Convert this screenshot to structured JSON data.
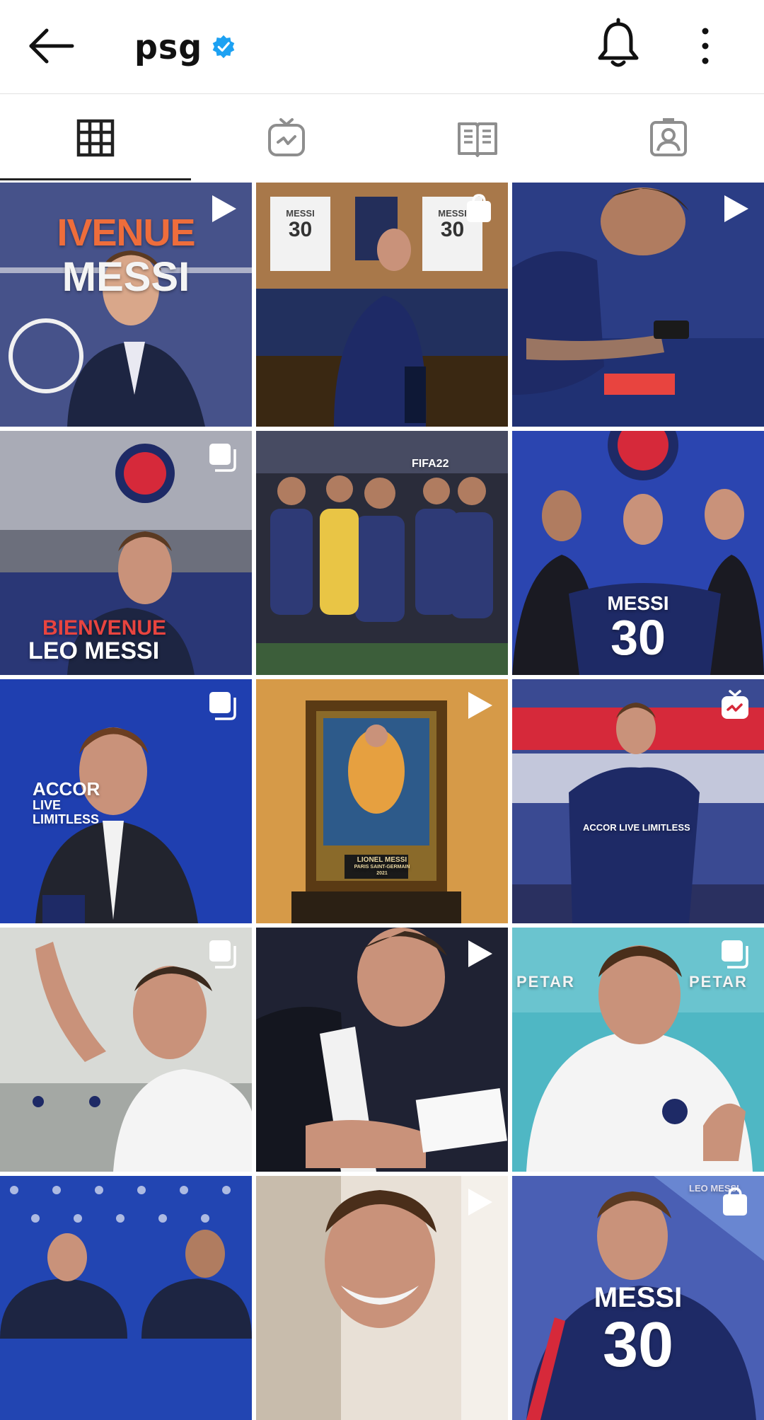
{
  "header": {
    "title": "psg",
    "verified": true,
    "back_icon": "arrow-left-icon",
    "bell_icon": "bell-icon",
    "more_icon": "more-vertical-icon"
  },
  "tabs": [
    {
      "name": "grid",
      "icon": "grid-icon",
      "active": true
    },
    {
      "name": "igtv",
      "icon": "igtv-icon",
      "active": false
    },
    {
      "name": "guides",
      "icon": "guides-icon",
      "active": false
    },
    {
      "name": "tagged",
      "icon": "tagged-icon",
      "active": false
    }
  ],
  "colors": {
    "accent_blue": "#1da1f2",
    "psg_navy": "#1e2a66",
    "psg_red": "#d6293a",
    "icon_dark": "#222222",
    "icon_gray": "#8e8e8e"
  },
  "posts": [
    {
      "type": "reel",
      "badge": "play-icon",
      "texts": [
        "IVENUE",
        "MESSI"
      ]
    },
    {
      "type": "shop",
      "badge": "shopping-bag-icon",
      "texts": [
        "MESSI",
        "30",
        "MESSI",
        "30"
      ]
    },
    {
      "type": "reel",
      "badge": "play-icon",
      "texts": []
    },
    {
      "type": "carousel",
      "badge": "carousel-icon",
      "texts": [
        "BIENVENUE",
        "LEO MESSI"
      ]
    },
    {
      "type": "photo",
      "badge": "",
      "texts": [
        "FIFA22"
      ]
    },
    {
      "type": "photo",
      "badge": "",
      "texts": [
        "MESSI",
        "30"
      ]
    },
    {
      "type": "carousel",
      "badge": "carousel-icon",
      "texts": [
        "ACCOR",
        "LIVE",
        "LIMITLESS"
      ]
    },
    {
      "type": "reel",
      "badge": "play-icon",
      "texts": [
        "LIONEL MESSI",
        "PARIS SAINT-GERMAIN",
        "2021"
      ]
    },
    {
      "type": "igtv",
      "badge": "igtv-icon",
      "texts": [
        "ACCOR LIVE LIMITLESS"
      ]
    },
    {
      "type": "carousel",
      "badge": "carousel-icon",
      "texts": []
    },
    {
      "type": "reel",
      "badge": "play-icon",
      "texts": []
    },
    {
      "type": "carousel",
      "badge": "carousel-icon",
      "texts": [
        "PETAR",
        "PETAR"
      ]
    },
    {
      "type": "photo",
      "badge": "",
      "texts": []
    },
    {
      "type": "reel",
      "badge": "play-icon",
      "texts": []
    },
    {
      "type": "shop",
      "badge": "shopping-bag-icon",
      "texts": [
        "LEO MESSI",
        "MESSI",
        "30"
      ]
    }
  ]
}
